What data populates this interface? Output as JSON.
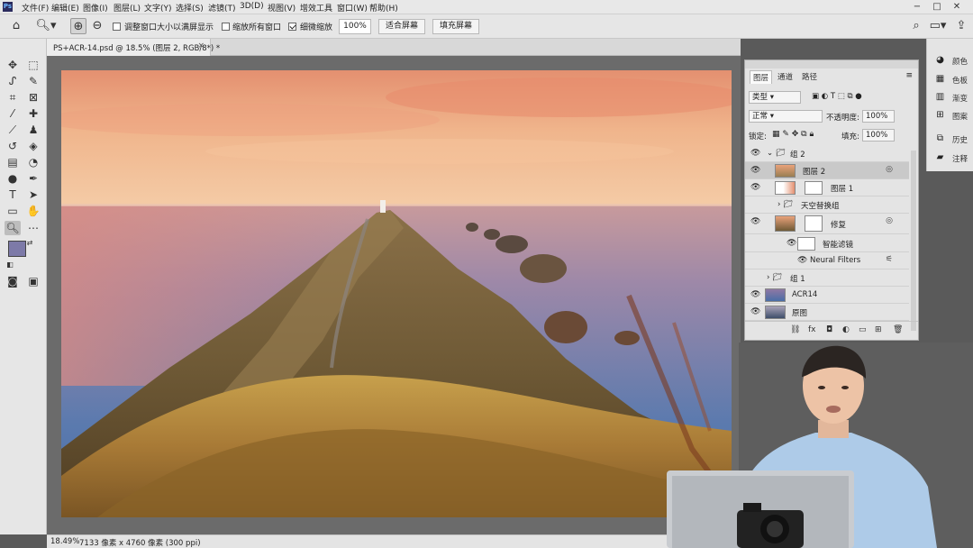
{
  "menubar": {
    "items": [
      "文件(F)",
      "编辑(E)",
      "图像(I)",
      "图层(L)",
      "文字(Y)",
      "选择(S)",
      "滤镜(T)",
      "3D(D)",
      "视图(V)",
      "增效工具",
      "窗口(W)",
      "帮助(H)"
    ],
    "app_logo": "Ps"
  },
  "options": {
    "resize_windows": "调整窗口大小以满屏显示",
    "zoom_all": "缩放所有窗口",
    "scrubby_zoom": "细微缩放",
    "zoom_value": "100%",
    "fit_screen": "适合屏幕",
    "fill_screen": "填充屏幕"
  },
  "document": {
    "tab_title": "PS+ACR-14.psd @ 18.5% (图层 2, RGB/8*) *",
    "close_glyph": "×"
  },
  "status": {
    "zoom": "18.49%",
    "dimensions": "7133 像素 x 4760 像素 (300 ppi)"
  },
  "layers_panel": {
    "tabs": [
      "图层",
      "通道",
      "路径"
    ],
    "filter_kind": "类型",
    "blend_mode": "正常",
    "opacity_label": "不透明度:",
    "opacity_value": "100%",
    "lock_label": "锁定:",
    "fill_label": "填充:",
    "fill_value": "100%",
    "layers": [
      {
        "name": "组 2",
        "type": "group"
      },
      {
        "name": "图层 2",
        "type": "pixel",
        "active": true
      },
      {
        "name": "图层 1",
        "type": "masked"
      },
      {
        "name": "天空替换组",
        "type": "group"
      },
      {
        "name": "修复",
        "type": "smart"
      },
      {
        "name": "智能滤镜",
        "type": "filter"
      },
      {
        "name": "Neural Filters",
        "type": "filter-item"
      },
      {
        "name": "组 1",
        "type": "group"
      },
      {
        "name": "ACR14",
        "type": "pixel"
      },
      {
        "name": "原图",
        "type": "pixel"
      }
    ]
  },
  "dock": {
    "items": [
      "颜色",
      "色板",
      "渐变",
      "图案",
      "历史",
      "注释"
    ]
  },
  "colors": {
    "sky_top": "#e9a27a",
    "sea": "#5d7db0",
    "grass": "#a9823e",
    "foreground_swatch": "#7d7aa8",
    "background_swatch": "#ffffff"
  }
}
